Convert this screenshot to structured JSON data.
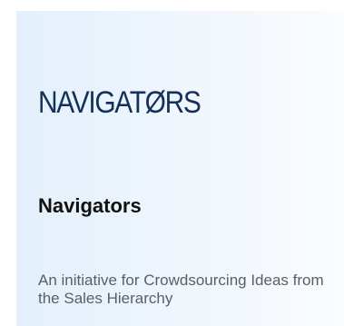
{
  "brand": {
    "logo_text": "NAVIGATØRS",
    "title": "Navigators",
    "description": "An initiative for Crowdsourcing Ideas from the Sales Hierarchy",
    "logo_color": "#15305a"
  }
}
